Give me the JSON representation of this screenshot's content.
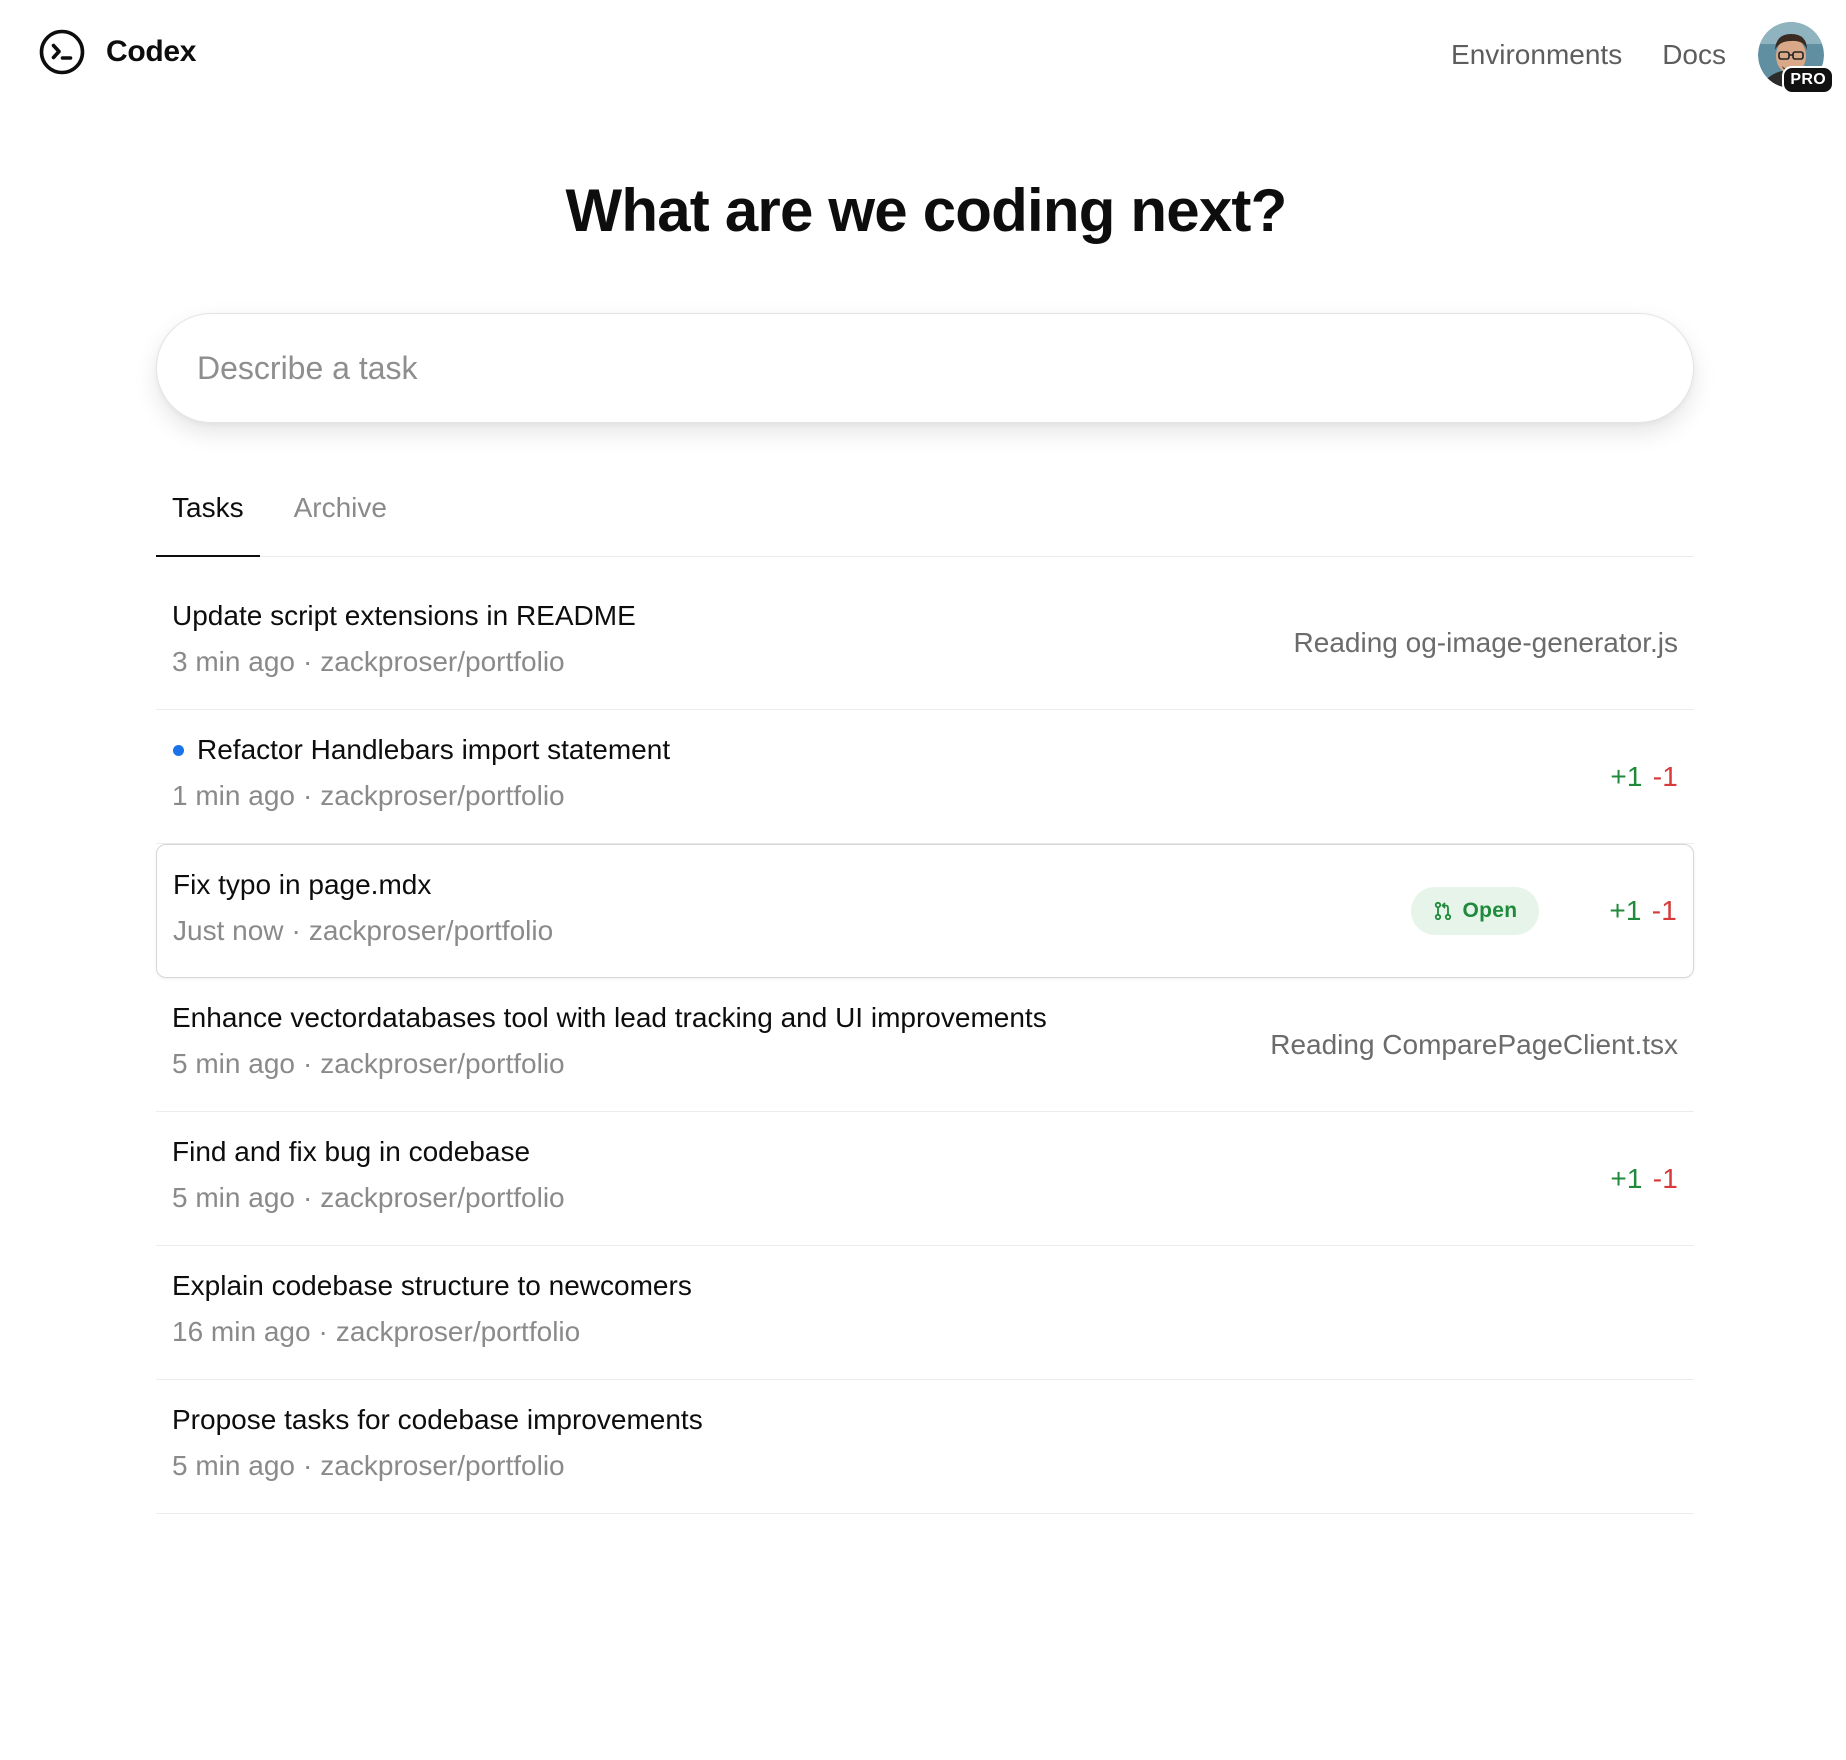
{
  "app": {
    "name": "Codex"
  },
  "nav": {
    "environments": "Environments",
    "docs": "Docs",
    "plan_badge": "PRO"
  },
  "hero": {
    "title": "What are we coding next?"
  },
  "composer": {
    "placeholder": "Describe a task",
    "value": ""
  },
  "tabs": [
    {
      "label": "Tasks",
      "active": true
    },
    {
      "label": "Archive",
      "active": false
    }
  ],
  "tasks": [
    {
      "title": "Update script extensions in README",
      "time": "3 min ago",
      "repo": "zackproser/portfolio",
      "status": "Reading og-image-generator.js",
      "unread": false
    },
    {
      "title": "Refactor Handlebars import statement",
      "time": "1 min ago",
      "repo": "zackproser/portfolio",
      "additions": "+1",
      "deletions": "-1",
      "unread": true
    },
    {
      "title": "Fix typo in page.mdx",
      "time": "Just now",
      "repo": "zackproser/portfolio",
      "pr_label": "Open",
      "additions": "+1",
      "deletions": "-1",
      "selected": true
    },
    {
      "title": "Enhance vectordatabases tool with lead tracking and UI improvements",
      "time": "5 min ago",
      "repo": "zackproser/portfolio",
      "status": "Reading ComparePageClient.tsx"
    },
    {
      "title": "Find and fix bug in codebase",
      "time": "5 min ago",
      "repo": "zackproser/portfolio",
      "additions": "+1",
      "deletions": "-1"
    },
    {
      "title": "Explain codebase structure to newcomers",
      "time": "16 min ago",
      "repo": "zackproser/portfolio"
    },
    {
      "title": "Propose tasks for codebase improvements",
      "time": "5 min ago",
      "repo": "zackproser/portfolio"
    }
  ],
  "meta_separator": "·",
  "colors": {
    "additions": "#1f8a3b",
    "deletions": "#d63a3a",
    "unread_dot": "#1a73e8",
    "pr_open_bg": "#e6f4ea"
  },
  "icons": {
    "logo": "codex-terminal-icon",
    "pr": "git-pull-request-icon"
  }
}
